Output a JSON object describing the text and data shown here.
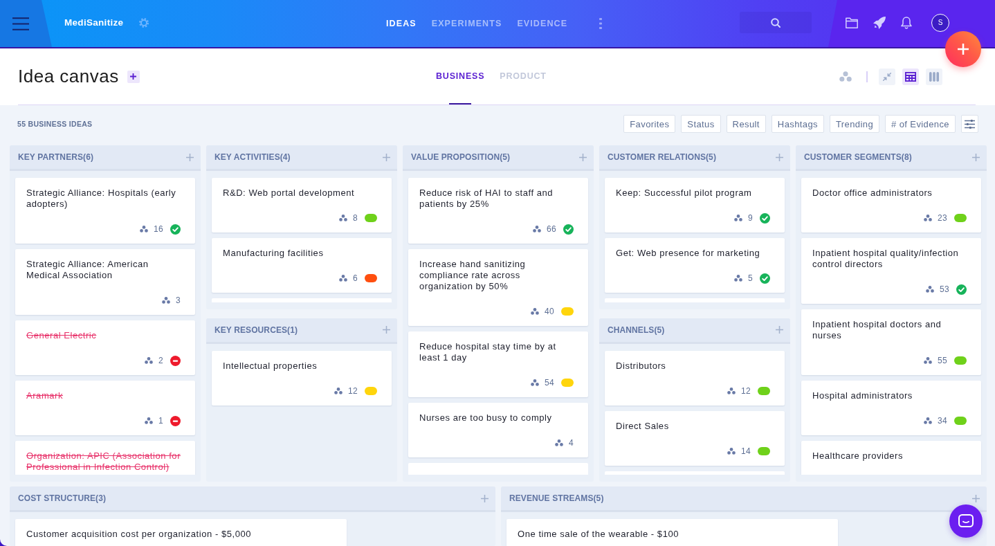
{
  "top_bar": {
    "app_name": "MediSanitize",
    "nav_tabs": [
      {
        "label": "IDEAS",
        "selected": true
      },
      {
        "label": "EXPERIMENTS",
        "selected": false
      },
      {
        "label": "EVIDENCE",
        "selected": false
      }
    ],
    "user": {
      "initial": "S"
    }
  },
  "page_header": {
    "title": "Idea canvas",
    "tabs": [
      {
        "label": "BUSINESS",
        "selected": true
      },
      {
        "label": "PRODUCT",
        "selected": false
      }
    ],
    "view_buttons": [
      {
        "kind": "collapse",
        "selected": false
      },
      {
        "kind": "grid",
        "selected": true
      },
      {
        "kind": "columns",
        "selected": false
      }
    ]
  },
  "filter_bar": {
    "count_label": "55 BUSINESS IDEAS",
    "filters": [
      "Favorites",
      "Status",
      "Result",
      "Hashtags",
      "Trending",
      "# of Evidence"
    ]
  },
  "canvas": {
    "columns": [
      {
        "sections": [
          {
            "title": "KEY PARTNERS(6)",
            "has_more": false,
            "cards": [
              {
                "kind": "check",
                "title": "Strategic Alliance: Hospitals (early adopters)",
                "count": "16",
                "crossed_out": false
              },
              {
                "kind": "plain",
                "title": "Strategic Alliance: American Medical Association",
                "count": "3",
                "crossed_out": false
              },
              {
                "kind": "minus",
                "title": "General Electric",
                "count": "2",
                "crossed_out": true
              },
              {
                "kind": "minus",
                "title": "Aramark",
                "count": "1",
                "crossed_out": true
              },
              {
                "title": "Organization: APIC (Association for Professional in Infection Control)",
                "crossed_out": true
              }
            ]
          }
        ]
      },
      {
        "sections": [
          {
            "title": "KEY ACTIVITIES(4)",
            "has_more": true,
            "cards": [
              {
                "kind": "dot",
                "title": "R&D: Web portal development",
                "count": "8",
                "color": "#6fd11a",
                "crossed_out": false
              },
              {
                "kind": "dot",
                "title": "Manufacturing facilities",
                "count": "6",
                "color": "#ff4f0f",
                "crossed_out": false
              }
            ]
          },
          {
            "title": "KEY RESOURCES(1)",
            "has_more": false,
            "cards": [
              {
                "kind": "dot",
                "title": "Intellectual properties",
                "count": "12",
                "color": "#ffd50c",
                "crossed_out": false
              }
            ]
          }
        ]
      },
      {
        "sections": [
          {
            "title": "VALUE PROPOSITION(5)",
            "has_more": true,
            "cards": [
              {
                "kind": "check",
                "title": "Reduce risk of HAI to staff and patients by 25%",
                "count": "66",
                "crossed_out": false
              },
              {
                "kind": "dot",
                "title": "Increase hand sanitizing compliance rate across organization by 50%",
                "count": "40",
                "color": "#ffd50c",
                "crossed_out": false
              },
              {
                "kind": "dot",
                "title": "Reduce hospital stay time by at least 1 day",
                "count": "54",
                "color": "#ffd50c",
                "crossed_out": false
              },
              {
                "kind": "plain",
                "title": "Nurses are too busy to comply",
                "count": "4",
                "crossed_out": false
              }
            ]
          }
        ]
      },
      {
        "sections": [
          {
            "title": "CUSTOMER RELATIONS(5)",
            "has_more": true,
            "cards": [
              {
                "kind": "check",
                "title": "Keep: Successful pilot program",
                "count": "9",
                "crossed_out": false
              },
              {
                "kind": "check",
                "title": "Get: Web presence for marketing",
                "count": "5",
                "crossed_out": false
              }
            ]
          },
          {
            "title": "CHANNELS(5)",
            "has_more": true,
            "cards": [
              {
                "kind": "dot",
                "title": "Distributors",
                "count": "12",
                "color": "#6fd11a",
                "crossed_out": false
              },
              {
                "kind": "dot",
                "title": "Direct Sales",
                "count": "14",
                "color": "#6fd11a",
                "crossed_out": false
              }
            ]
          }
        ]
      },
      {
        "sections": [
          {
            "title": "CUSTOMER SEGMENTS(8)",
            "has_more": false,
            "cards": [
              {
                "kind": "dot",
                "title": "Doctor office administrators",
                "count": "23",
                "color": "#6fd11a",
                "crossed_out": false
              },
              {
                "kind": "check",
                "title": "Inpatient hospital quality/infection control directors",
                "count": "53",
                "crossed_out": false
              },
              {
                "kind": "dot",
                "title": "Inpatient hospital doctors and nurses",
                "count": "55",
                "color": "#6fd11a",
                "crossed_out": false
              },
              {
                "kind": "dot",
                "title": "Hospital administrators",
                "count": "34",
                "color": "#6fd11a",
                "crossed_out": false
              },
              {
                "title": "Healthcare providers",
                "crossed_out": false
              }
            ]
          }
        ]
      }
    ],
    "bottom_row": [
      {
        "title": "COST STRUCTURE(3)",
        "has_more": false,
        "cards": [
          {
            "title": "Customer acquisition cost per organization - $5,000",
            "crossed_out": false
          }
        ]
      },
      {
        "title": "REVENUE STREAMS(5)",
        "has_more": false,
        "cards": [
          {
            "title": "One time sale of the wearable - $100",
            "crossed_out": false
          }
        ]
      }
    ]
  }
}
